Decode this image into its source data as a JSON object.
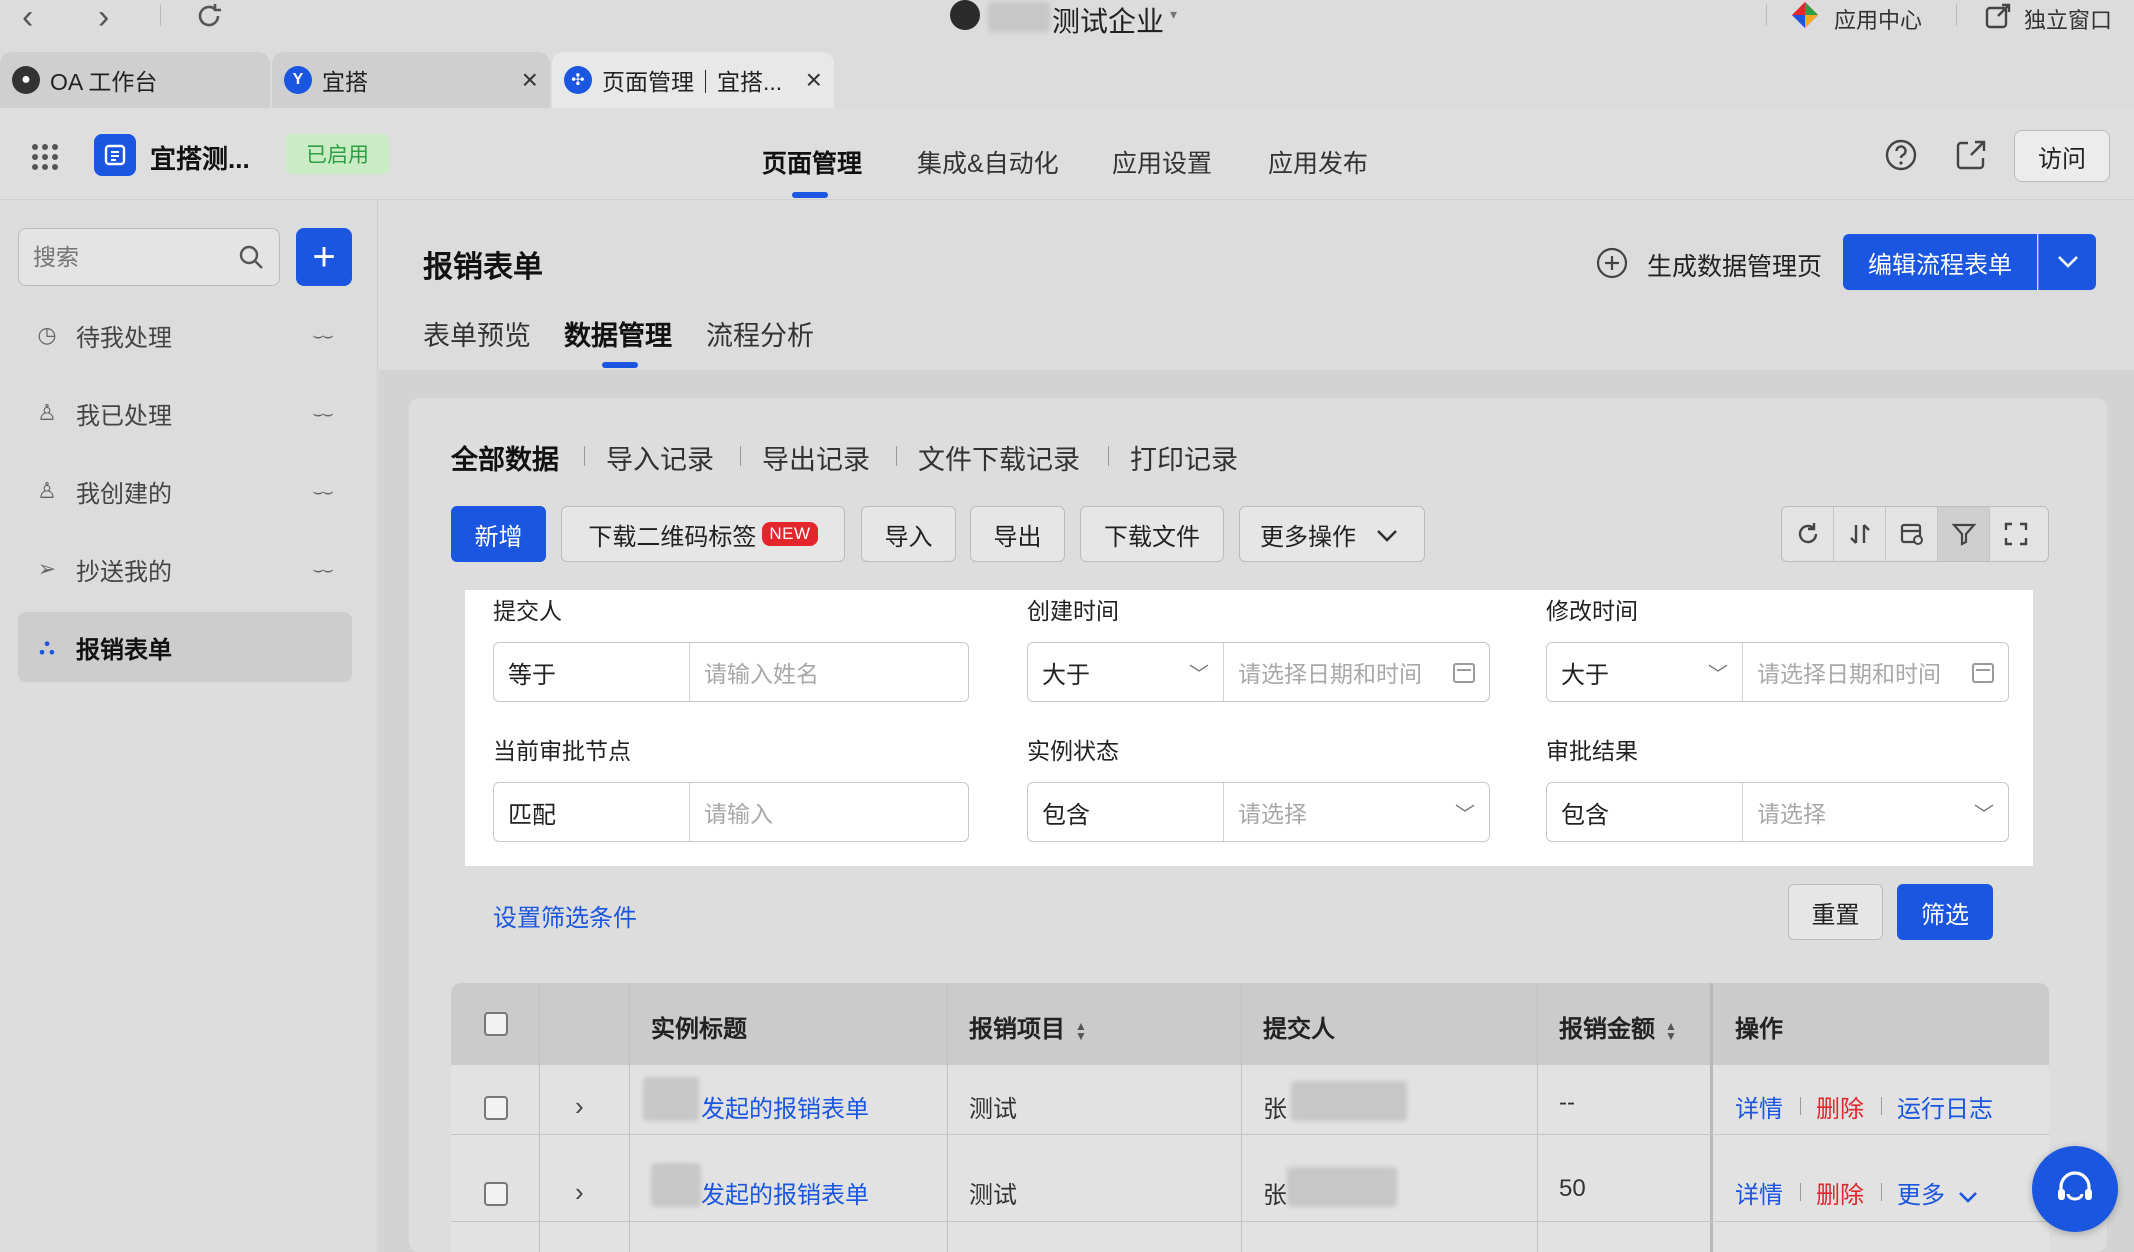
{
  "topbar": {
    "company": "测试企业",
    "app_center": "应用中心",
    "standalone": "独立窗口"
  },
  "tabs": [
    {
      "label": "OA 工作台"
    },
    {
      "label": "宜搭"
    },
    {
      "label": "页面管理｜宜搭..."
    }
  ],
  "header": {
    "app_name": "宜搭测...",
    "status": "已启用",
    "nav": [
      "页面管理",
      "集成&自动化",
      "应用设置",
      "应用发布"
    ],
    "visit_label": "访问"
  },
  "sidebar": {
    "search_placeholder": "搜索",
    "items": [
      {
        "label": "待我处理"
      },
      {
        "label": "我已处理"
      },
      {
        "label": "我创建的"
      },
      {
        "label": "抄送我的"
      },
      {
        "label": "报销表单"
      }
    ]
  },
  "page": {
    "title": "报销表单",
    "generate_label": "生成数据管理页",
    "edit_label": "编辑流程表单",
    "subtabs": [
      "表单预览",
      "数据管理",
      "流程分析"
    ]
  },
  "data_tabs": [
    "全部数据",
    "导入记录",
    "导出记录",
    "文件下载记录",
    "打印记录"
  ],
  "toolbar": {
    "add": "新增",
    "qr": "下载二维码标签",
    "new_badge": "NEW",
    "import": "导入",
    "export": "导出",
    "download": "下载文件",
    "more": "更多操作"
  },
  "filters": {
    "submitter": {
      "label": "提交人",
      "op": "等于",
      "placeholder": "请输入姓名"
    },
    "created": {
      "label": "创建时间",
      "op": "大于",
      "placeholder": "请选择日期和时间"
    },
    "modified": {
      "label": "修改时间",
      "op": "大于",
      "placeholder": "请选择日期和时间"
    },
    "node": {
      "label": "当前审批节点",
      "op": "匹配",
      "placeholder": "请输入"
    },
    "status": {
      "label": "实例状态",
      "op": "包含",
      "placeholder": "请选择"
    },
    "result": {
      "label": "审批结果",
      "op": "包含",
      "placeholder": "请选择"
    },
    "set_conditions": "设置筛选条件",
    "reset": "重置",
    "apply": "筛选"
  },
  "table": {
    "columns": [
      "实例标题",
      "报销项目",
      "提交人",
      "报销金额",
      "操作"
    ],
    "rows": [
      {
        "title": "发起的报销表单",
        "project": "测试",
        "submitter": "张",
        "amount": "--",
        "ops": [
          "详情",
          "删除",
          "运行日志"
        ]
      },
      {
        "title": "发起的报销表单",
        "project": "测试",
        "submitter": "张",
        "amount": "50",
        "ops": [
          "详情",
          "删除",
          "更多"
        ]
      }
    ]
  },
  "colors": {
    "primary": "#1b56e0",
    "danger": "#e3262c",
    "success_bg": "#c9ecc4",
    "success_text": "#2f9e44"
  }
}
